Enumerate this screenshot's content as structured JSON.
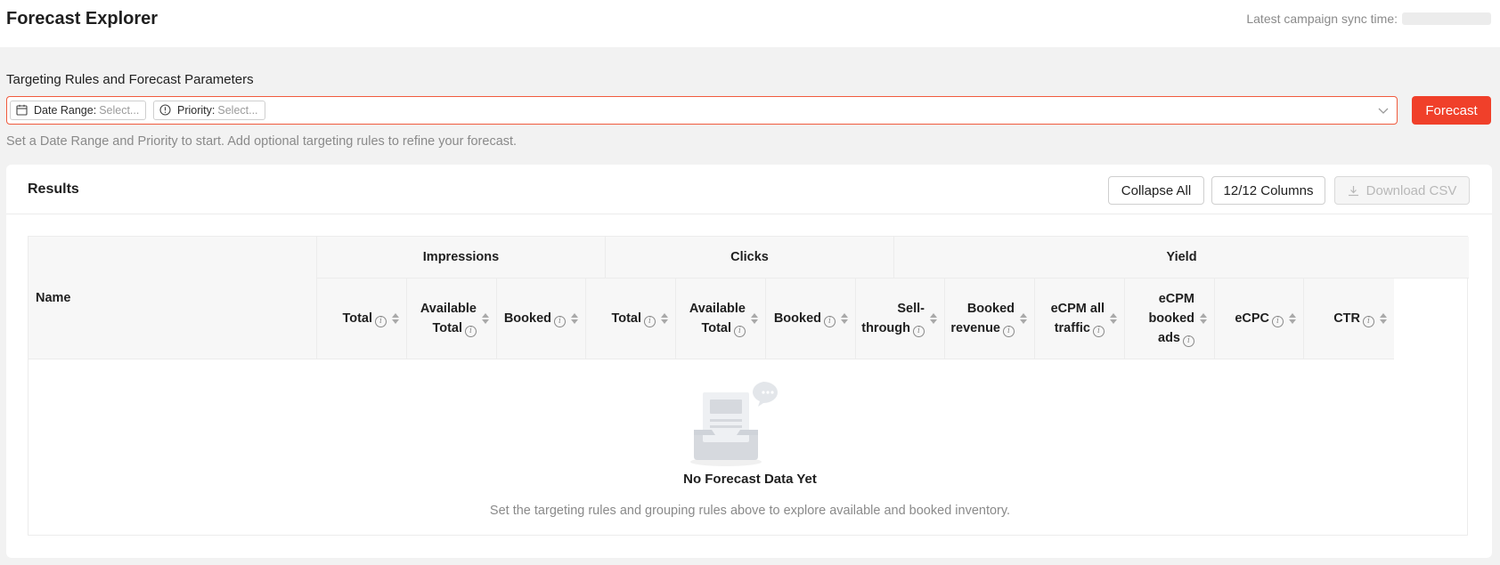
{
  "header": {
    "title": "Forecast Explorer",
    "sync_label": "Latest campaign sync time:"
  },
  "params": {
    "section_label": "Targeting Rules and Forecast Parameters",
    "chips": [
      {
        "label": "Date Range:",
        "value": "Select...",
        "icon": "calendar-icon"
      },
      {
        "label": "Priority:",
        "value": "Select...",
        "icon": "priority-icon"
      }
    ],
    "forecast_button": "Forecast",
    "helper_text": "Set a Date Range and Priority to start. Add optional targeting rules to refine your forecast."
  },
  "results": {
    "title": "Results",
    "collapse_all": "Collapse All",
    "columns_button": "12/12 Columns",
    "download_csv": "Download CSV"
  },
  "table": {
    "name_header": "Name",
    "groups": [
      "Impressions",
      "Clicks",
      "Yield"
    ],
    "columns": [
      {
        "lines": [
          "Total"
        ]
      },
      {
        "lines": [
          "Available",
          "Total"
        ]
      },
      {
        "lines": [
          "Booked"
        ]
      },
      {
        "lines": [
          "Total"
        ]
      },
      {
        "lines": [
          "Available",
          "Total"
        ]
      },
      {
        "lines": [
          "Booked"
        ]
      },
      {
        "lines": [
          "Sell-",
          "through"
        ]
      },
      {
        "lines": [
          "Booked",
          "revenue"
        ]
      },
      {
        "lines": [
          "eCPM all",
          "traffic"
        ]
      },
      {
        "lines": [
          "eCPM",
          "booked",
          "ads"
        ]
      },
      {
        "lines": [
          "eCPC"
        ]
      },
      {
        "lines": [
          "CTR"
        ]
      }
    ]
  },
  "empty_state": {
    "title": "No Forecast Data Yet",
    "description": "Set the targeting rules and grouping rules above to explore available and booked inventory."
  },
  "colors": {
    "accent": "#f0402a",
    "border_active": "#f05a3d"
  }
}
